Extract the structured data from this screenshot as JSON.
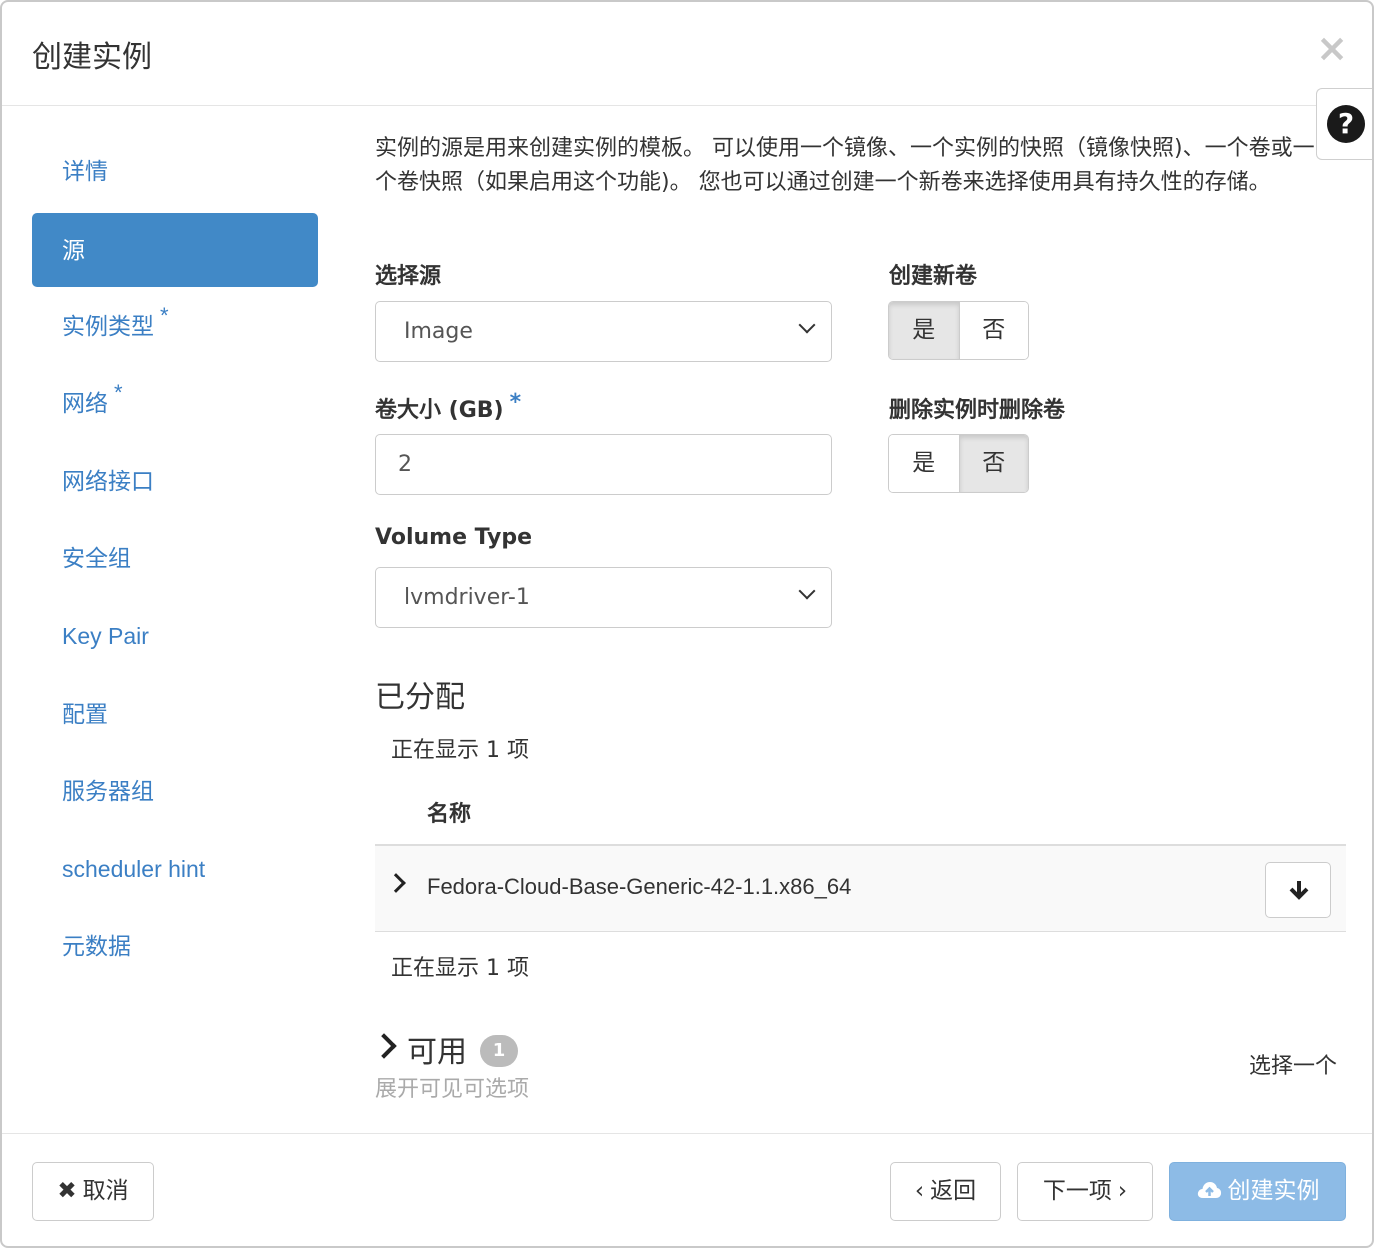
{
  "dialog": {
    "title": "创建实例",
    "close_label": "×",
    "help_label": "?"
  },
  "sidebar": {
    "items": [
      {
        "label": "详情",
        "required": false,
        "active": false
      },
      {
        "label": "源",
        "required": false,
        "active": true
      },
      {
        "label": "实例类型",
        "required": true,
        "active": false
      },
      {
        "label": "网络",
        "required": true,
        "active": false
      },
      {
        "label": "网络接口",
        "required": false,
        "active": false
      },
      {
        "label": "安全组",
        "required": false,
        "active": false
      },
      {
        "label": "Key Pair",
        "required": false,
        "active": false
      },
      {
        "label": "配置",
        "required": false,
        "active": false
      },
      {
        "label": "服务器组",
        "required": false,
        "active": false
      },
      {
        "label": "scheduler hint",
        "required": false,
        "active": false
      },
      {
        "label": "元数据",
        "required": false,
        "active": false
      }
    ],
    "required_mark": "*"
  },
  "source": {
    "intro": "实例的源是用来创建实例的模板。 可以使用一个镜像、一个实例的快照（镜像快照)、一个卷或一个卷快照（如果启用这个功能)。 您也可以通过创建一个新卷来选择使用具有持久性的存储。",
    "select_source_label": "选择源",
    "select_source_value": "Image",
    "volume_size_label": "卷大小 (GB)",
    "volume_size_value": "2",
    "volume_type_label": "Volume Type",
    "volume_type_value": "lvmdriver-1",
    "create_volume_label": "创建新卷",
    "delete_volume_label": "删除实例时删除卷",
    "yes": "是",
    "no": "否",
    "create_volume_selected": "yes",
    "delete_volume_selected": "no"
  },
  "allocated": {
    "title": "已分配",
    "count_top": "正在显示 1 项",
    "column_name": "名称",
    "rows": [
      {
        "name": "Fedora-Cloud-Base-Generic-42-1.1.x86_64"
      }
    ],
    "count_bottom": "正在显示 1 项"
  },
  "available": {
    "title": "可用",
    "badge": "1",
    "hint": "展开可见可选项",
    "choose_one": "选择一个"
  },
  "footer": {
    "cancel": "取消",
    "back": "返回",
    "next": "下一项",
    "create": "创建实例"
  }
}
